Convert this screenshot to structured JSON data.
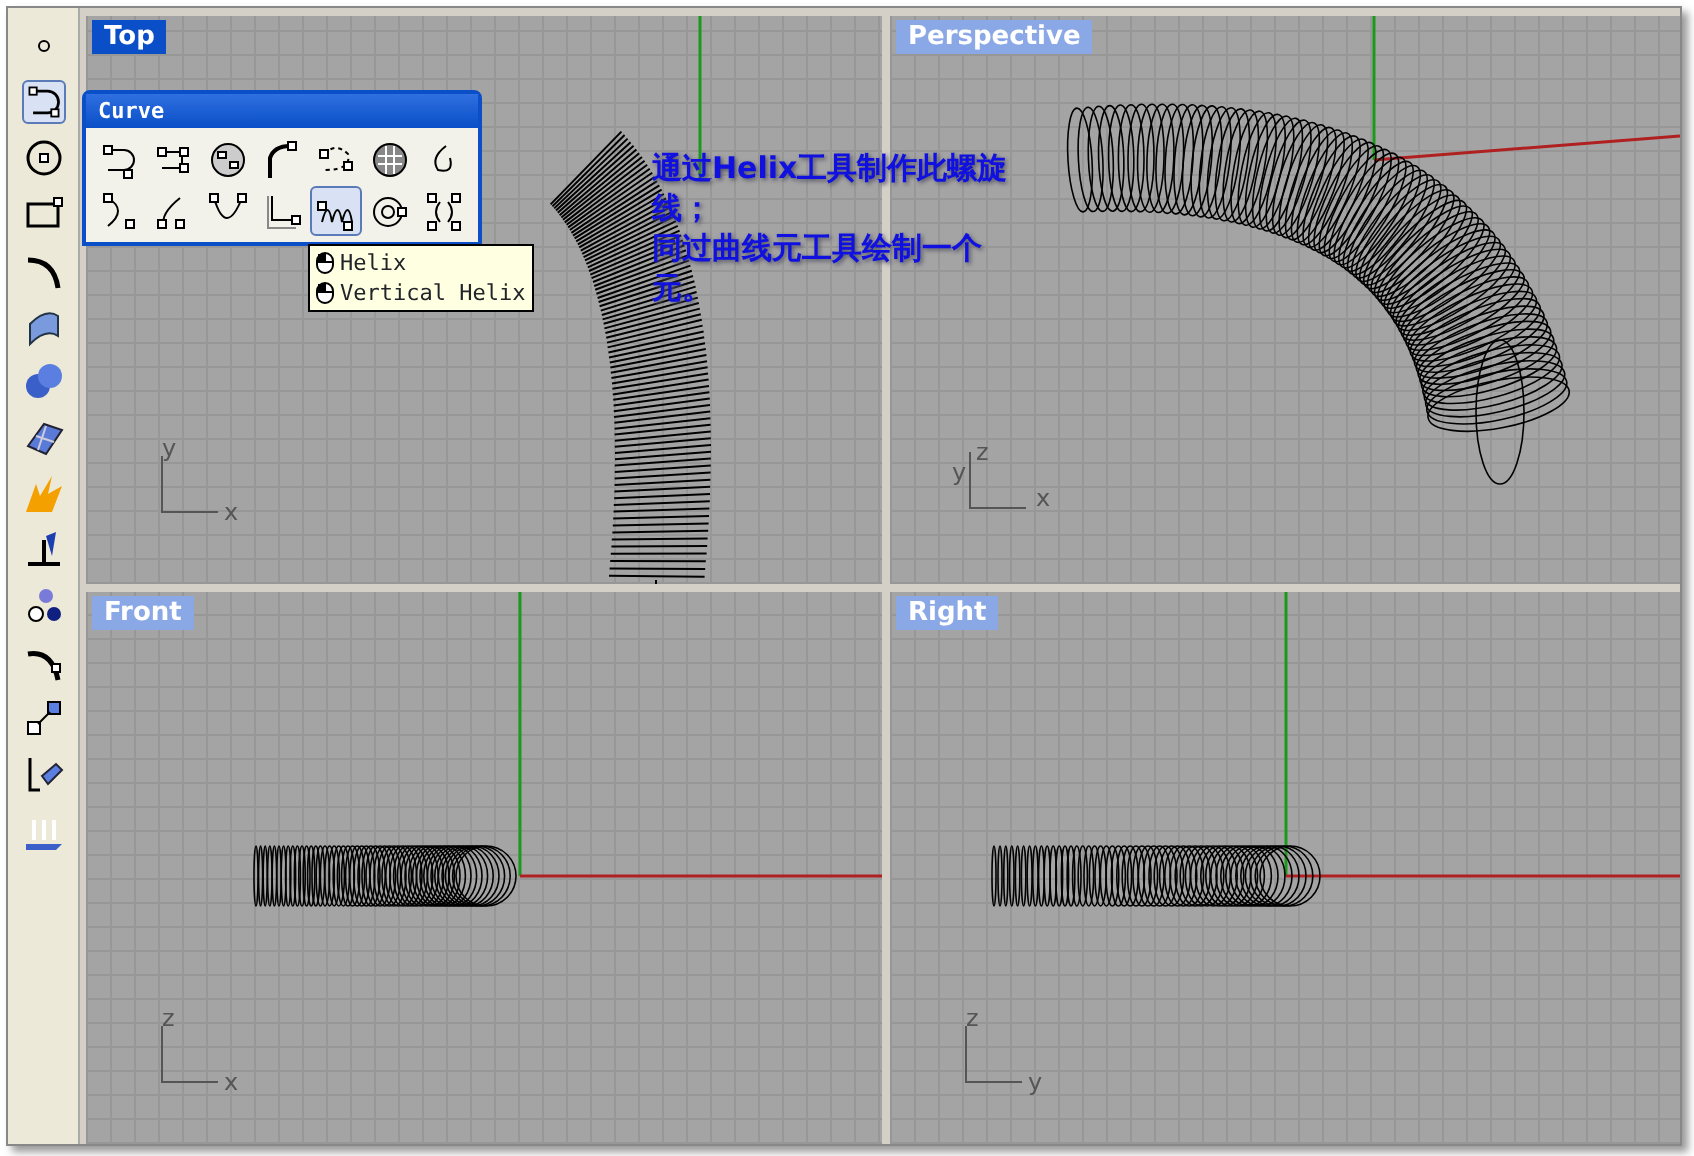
{
  "viewports": [
    {
      "title": "Top",
      "selected": true,
      "axes": [
        "y",
        "x"
      ]
    },
    {
      "title": "Perspective",
      "selected": false,
      "axes": [
        "z",
        "y",
        "x"
      ]
    },
    {
      "title": "Front",
      "selected": false,
      "axes": [
        "z",
        "x"
      ]
    },
    {
      "title": "Right",
      "selected": false,
      "axes": [
        "z",
        "y"
      ]
    }
  ],
  "palette": {
    "title": "Curve",
    "tools": [
      {
        "selected": false
      },
      {
        "selected": false
      },
      {
        "selected": false
      },
      {
        "selected": false
      },
      {
        "selected": false
      },
      {
        "selected": false
      },
      {
        "selected": false
      },
      {
        "selected": false
      },
      {
        "selected": false
      },
      {
        "selected": false
      },
      {
        "selected": false
      },
      {
        "selected": true
      },
      {
        "selected": false
      },
      {
        "selected": false
      }
    ]
  },
  "tooltip": {
    "items": [
      "Helix",
      "Vertical Helix"
    ]
  },
  "note": [
    "通过Helix工具制作此螺旋线；",
    "同过曲线元工具绘制一个元。"
  ]
}
